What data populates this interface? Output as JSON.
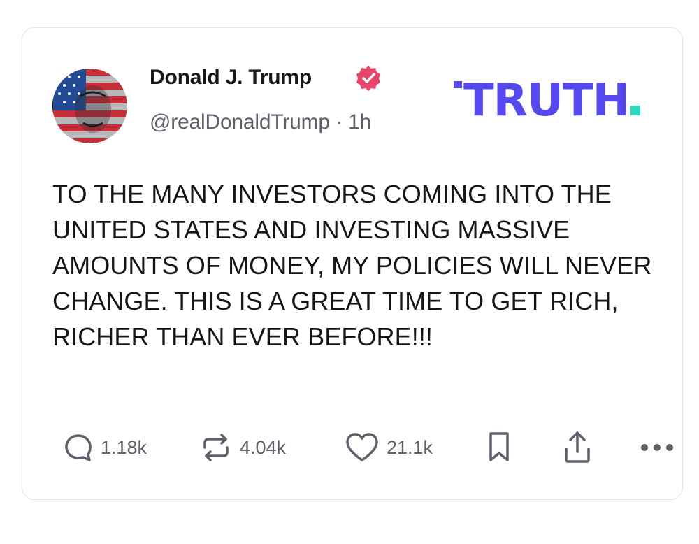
{
  "post": {
    "author_name": "Donald J. Trump",
    "handle": "@realDonaldTrump",
    "separator": "·",
    "time_ago": "1h",
    "text": "TO THE MANY INVESTORS COMING INTO THE UNITED STATES AND INVESTING MASSIVE AMOUNTS OF MONEY, MY POLICIES WILL NEVER CHANGE. THIS IS A GREAT TIME TO GET RICH, RICHER THAN EVER BEFORE!!!"
  },
  "brand": {
    "logo_text": "TRUTH",
    "logo_color": "#5448ee",
    "dot_color": "#2bd9c0",
    "verified_color": "#e8456b"
  },
  "actions": {
    "replies": "1.18k",
    "retruths": "4.04k",
    "likes": "21.1k",
    "icons": [
      "reply-icon",
      "retruth-icon",
      "like-icon",
      "bookmark-icon",
      "share-icon",
      "more-icon"
    ]
  }
}
